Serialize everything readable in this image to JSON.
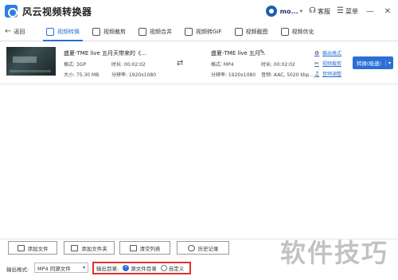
{
  "app": {
    "title": "风云视频转换器",
    "user": "mo...",
    "service_label": "客服",
    "menu_label": "菜单"
  },
  "nav": {
    "back_label": "返回",
    "tabs": [
      {
        "label": "视频转换",
        "icon": "video-convert-icon",
        "active": true
      },
      {
        "label": "视频裁剪",
        "icon": "video-trim-icon",
        "active": false
      },
      {
        "label": "视频合并",
        "icon": "video-merge-icon",
        "active": false
      },
      {
        "label": "视频转GIF",
        "icon": "video-gif-icon",
        "active": false
      },
      {
        "label": "视频截图",
        "icon": "video-screenshot-icon",
        "active": false
      },
      {
        "label": "视频优化",
        "icon": "video-optimize-icon",
        "active": false
      }
    ]
  },
  "file": {
    "source_name": "盛夏-TME live 五月天带来的《...",
    "source_format": "格式: 3GP",
    "source_duration": "时长: 00:02:02",
    "source_size": "大小: 75.30 MB",
    "source_resolution": "分辨率: 1920x1080",
    "output_name": "盛夏-TME live 五月...",
    "output_format": "格式: MP4",
    "output_duration": "时长: 00:02:02",
    "output_resolution": "分辨率: 1920x1080",
    "output_audio": "音频: AAC, 5020 kbp...",
    "actions": [
      "输出格式",
      "视频裁剪",
      "音频调整"
    ],
    "convert_label": "转换(极速)"
  },
  "bottom": {
    "buttons": [
      "添加文件",
      "添加文件夹",
      "清空列表",
      "历史记录"
    ],
    "format_label": "输出格式:",
    "format_value": "MP4 同源文件",
    "dir_label": "输出目录:",
    "dir_options": [
      {
        "label": "源文件目录",
        "selected": true
      },
      {
        "label": "自定义",
        "selected": false
      }
    ]
  },
  "watermark": "软件技巧",
  "colors": {
    "accent": "#2a6fd6",
    "highlight": "#e03030"
  }
}
